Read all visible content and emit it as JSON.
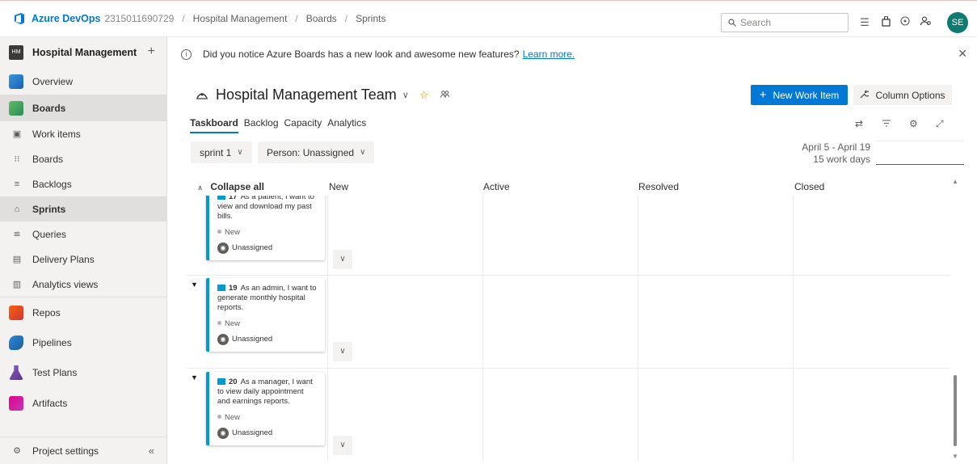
{
  "header": {
    "product": "Azure DevOps",
    "org": "2315011690729",
    "breadcrumbs": [
      "Hospital Management",
      "Boards",
      "Sprints"
    ],
    "search_placeholder": "Search",
    "avatar_initials": "SE"
  },
  "sidebar": {
    "project_badge": "HM",
    "project_name": "Hospital Management",
    "add": "+",
    "items": [
      {
        "label": "Overview",
        "icon": "overview-icon"
      },
      {
        "label": "Boards",
        "icon": "boards-icon"
      },
      {
        "label": "Work items",
        "icon": "work-items-icon"
      },
      {
        "label": "Boards",
        "icon": "kanban-icon"
      },
      {
        "label": "Backlogs",
        "icon": "backlogs-icon"
      },
      {
        "label": "Sprints",
        "icon": "sprints-icon"
      },
      {
        "label": "Queries",
        "icon": "queries-icon"
      },
      {
        "label": "Delivery Plans",
        "icon": "delivery-plans-icon"
      },
      {
        "label": "Analytics views",
        "icon": "analytics-icon"
      },
      {
        "label": "Repos",
        "icon": "repos-icon"
      },
      {
        "label": "Pipelines",
        "icon": "pipelines-icon"
      },
      {
        "label": "Test Plans",
        "icon": "test-plans-icon"
      },
      {
        "label": "Artifacts",
        "icon": "artifacts-icon"
      }
    ],
    "settings_label": "Project settings",
    "collapse": "«"
  },
  "banner": {
    "text": "Did you notice Azure Boards has a new look and awesome new features?",
    "link": "Learn more."
  },
  "team": {
    "name": "Hospital Management Team"
  },
  "actions": {
    "new_work_item": "New Work Item",
    "column_options": "Column Options"
  },
  "tabs": [
    "Taskboard",
    "Backlog",
    "Capacity",
    "Analytics"
  ],
  "filters": {
    "sprint": "sprint 1",
    "person": "Person: Unassigned"
  },
  "date": {
    "range": "April 5 - April 19",
    "work_days": "15 work days"
  },
  "board": {
    "collapse_all": "Collapse all",
    "columns": [
      "New",
      "Active",
      "Resolved",
      "Closed"
    ],
    "cards": [
      {
        "id": "17",
        "title": "As a patient, I want to view and download my past bills.",
        "state": "New",
        "assignee": "Unassigned"
      },
      {
        "id": "19",
        "title": "As an admin, I want to generate monthly hospital reports.",
        "state": "New",
        "assignee": "Unassigned"
      },
      {
        "id": "20",
        "title": "As a manager, I want to view daily appointment and earnings reports.",
        "state": "New",
        "assignee": "Unassigned"
      }
    ]
  },
  "colors": {
    "accent": "#0078d4",
    "card_border": "#009ccc",
    "avatar": "#0e7a72"
  }
}
